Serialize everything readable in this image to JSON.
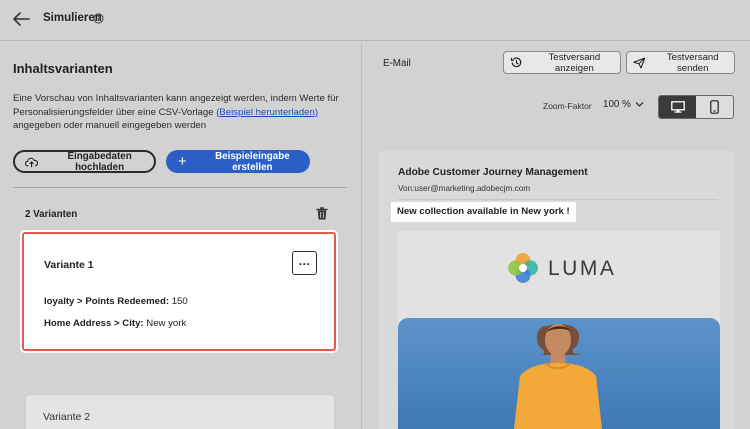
{
  "header": {
    "title": "Simulieren",
    "icons": {
      "back": "arrow-left-icon",
      "info": "info-icon"
    }
  },
  "left": {
    "title": "Inhaltsvarianten",
    "description_before": "Eine Vorschau von Inhaltsvarianten kann angezeigt werden, indem Werte für Personalisierungsfelder über eine CSV-Vorlage ",
    "description_link": "(Beispiel herunterladen)",
    "description_after": " angegeben oder manuell eingegeben werden",
    "upload_label": "Eingabedaten hochladen",
    "create_label": "Beispieleingabe erstellen",
    "variant_count": "2 Varianten",
    "variants": [
      {
        "name": "Variante 1",
        "fields": [
          {
            "label": "loyalty > Points Redeemed:",
            "value": " 150"
          },
          {
            "label": "Home Address > City:",
            "value": " New york"
          }
        ]
      },
      {
        "name": "Variante 2"
      }
    ]
  },
  "right": {
    "channel_label": "E-Mail",
    "test_show_label": "Testversand anzeigen",
    "test_send_label": "Testversand senden",
    "zoom_label": "Zoom-Faktor",
    "zoom_value": "100 %",
    "preview": {
      "sender_name": "Adobe Customer Journey Management",
      "from_line": "Von:user@marketing.adobecjm.com",
      "subject": "New collection available in New york !",
      "brand": "LUMA"
    }
  },
  "colors": {
    "accent": "#2b5fc7",
    "selected_border": "#e55a4a",
    "background": "#d2d2d2"
  }
}
